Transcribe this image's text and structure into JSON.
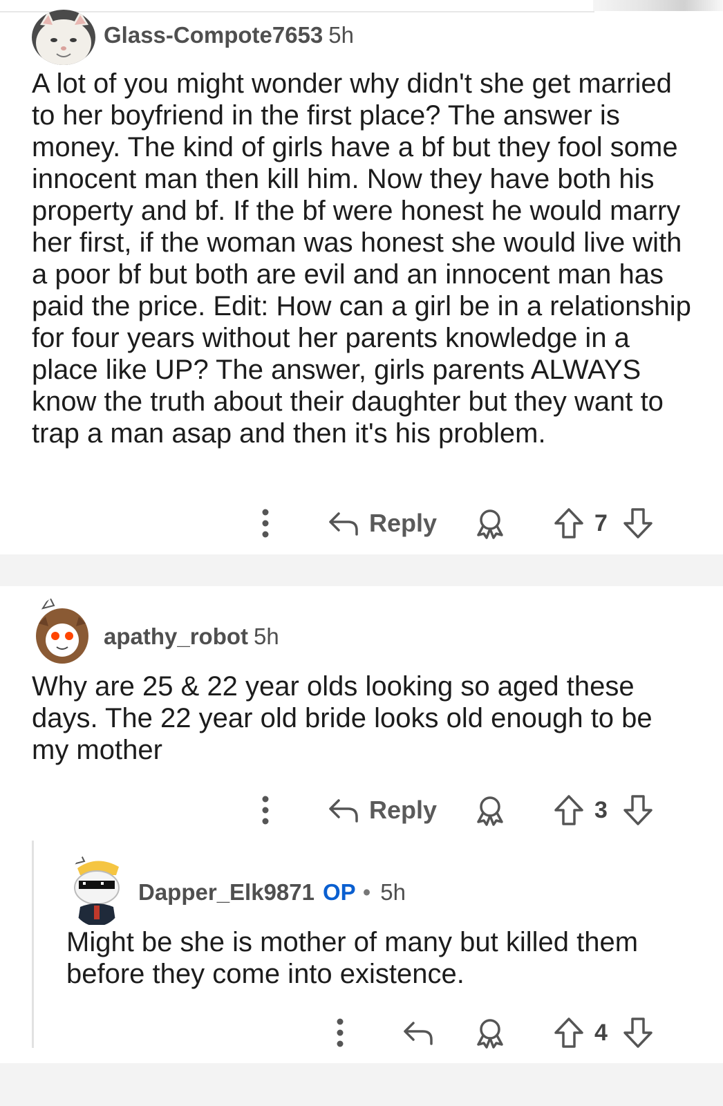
{
  "comments": [
    {
      "username": "Glass-Compote7653",
      "time": "5h",
      "body": "A lot of you might wonder why didn't she get married to her boyfriend in the first place? The answer is money. The kind of girls have a bf but they fool some innocent man then kill him. Now they have both his property and bf. If the bf were honest he would marry her first, if the woman was honest she would live with a poor bf but both are evil and an innocent man has paid the price. Edit: How can a girl be in a relationship for four years without her parents knowledge in a place like UP? The answer, girls parents ALWAYS know the truth about their daughter but they want to trap a man asap and then it's his problem.",
      "reply_label": "Reply",
      "score": "7",
      "avatar_icon": "cat-avatar-icon"
    },
    {
      "username": "apathy_robot",
      "time": "5h",
      "body": "Why are 25 & 22 year olds looking so aged these days. The 22 year old bride looks old enough to be my mother",
      "reply_label": "Reply",
      "score": "3",
      "avatar_icon": "owl-avatar-icon"
    },
    {
      "username": "Dapper_Elk9871",
      "op_badge": "OP",
      "separator": "•",
      "time": "5h",
      "body": "Might be she is mother of many but killed them before they come into existence.",
      "score": "4",
      "avatar_icon": "sunglasses-avatar-icon"
    }
  ],
  "icons": {
    "more": "more-vertical-icon",
    "reply": "reply-arrow-icon",
    "award": "award-icon",
    "upvote": "upvote-arrow-icon",
    "downvote": "downvote-arrow-icon"
  },
  "colors": {
    "op_badge": "#0a5fd0",
    "text": "#1c1c1c",
    "meta": "#4f4f4f",
    "divider": "#f3f3f3"
  }
}
